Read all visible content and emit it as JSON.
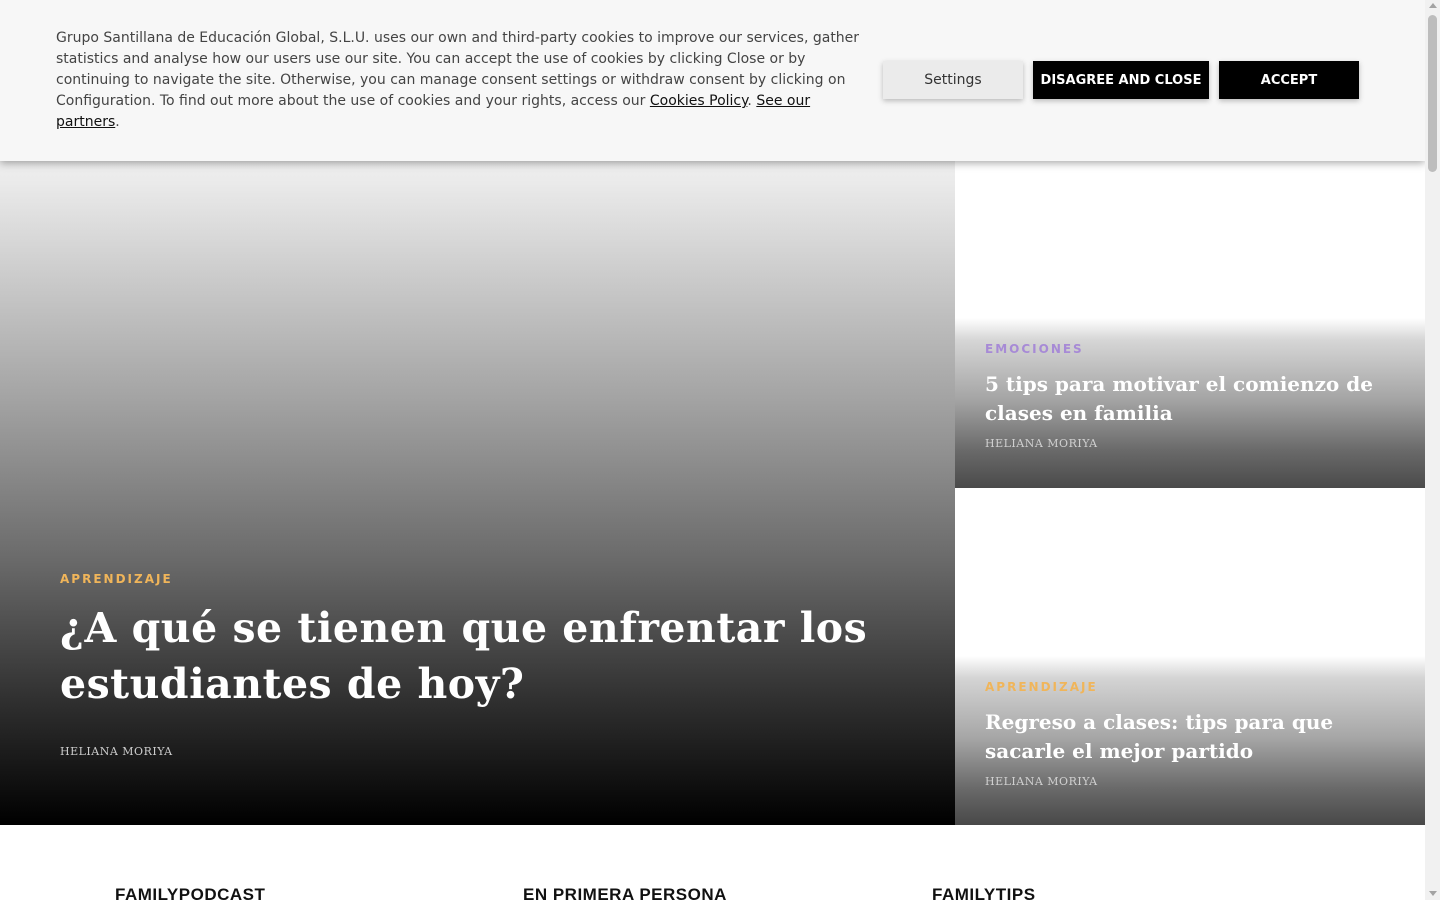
{
  "cookie_banner": {
    "text": "Grupo Santillana de Educación Global, S.L.U. uses our own and third-party cookies to improve our services, gather statistics and analyse how our users use our site. You can accept the use of cookies by clicking Close or by continuing to navigate the site. Otherwise, you can manage consent settings or withdraw consent by clicking on Configuration. To find out more about the use of cookies and your rights, access our",
    "cookies_policy_link": "Cookies Policy",
    "separator": ".",
    "partners_link": "See our partners",
    "end_period": ".",
    "settings_label": "Settings",
    "disagree_label": "DISAGREE AND CLOSE",
    "accept_label": "ACCEPT"
  },
  "hero": {
    "category": "APRENDIZAJE",
    "title": "¿A qué se tienen que enfrentar los estudiantes de hoy?",
    "author": "HELIANA MORIYA"
  },
  "cards": [
    {
      "category": "EMOCIONES",
      "title": "5 tips para motivar el comienzo de clases en familia",
      "author": "HELIANA MORIYA"
    },
    {
      "category": "APRENDIZAJE",
      "title": "Regreso a clases: tips para que sacarle el mejor partido",
      "author": "HELIANA MORIYA"
    }
  ],
  "sections": [
    "FAMILYPODCAST",
    "EN PRIMERA PERSONA",
    "FAMILYTIPS"
  ],
  "colors": {
    "aprendizaje": "#f0b55a",
    "emociones": "#a78ad6",
    "button_dark": "#000000",
    "banner_bg": "#f7f7f7"
  }
}
